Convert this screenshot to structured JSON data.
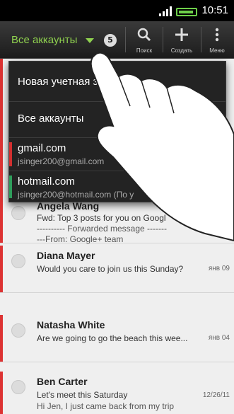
{
  "status_bar": {
    "time": "10:51"
  },
  "action_bar": {
    "account_label": "Все аккаунты",
    "unread_count": "5",
    "search_label": "Поиск",
    "compose_label": "Создать",
    "menu_label": "Меню"
  },
  "dropdown": {
    "new_account": "Новая учетная запись",
    "all_accounts": "Все аккаунты",
    "accounts": [
      {
        "name": "gmail.com",
        "email": "jsinger200@gmail.com",
        "color": "#d32f2f"
      },
      {
        "name": "hotmail.com",
        "email": "jsinger200@hotmail.com (По у",
        "color": "#2e9e5b"
      }
    ]
  },
  "mail_list": [
    {
      "sender": "Angela Wang",
      "subject": "Fwd: Top 3 posts for you on Googl",
      "line3": "---------- Forwarded message -------",
      "line4": "---From: Google+ team",
      "date": ""
    },
    {
      "sender": "Diana Mayer",
      "subject": "Would you care to join us this Sunday?",
      "date": "янв 09"
    },
    {
      "sender": "Natasha White",
      "subject": "Are we going to go the beach this wee...",
      "date": "янв 04"
    },
    {
      "sender": "Ben Carter",
      "subject": "Let's meet this Saturday",
      "line3": "Hi Jen, I just came back from my trip",
      "date": "12/26/11"
    }
  ],
  "colors": {
    "accent": "#8fd14f",
    "unread_bar": "#d33333"
  }
}
